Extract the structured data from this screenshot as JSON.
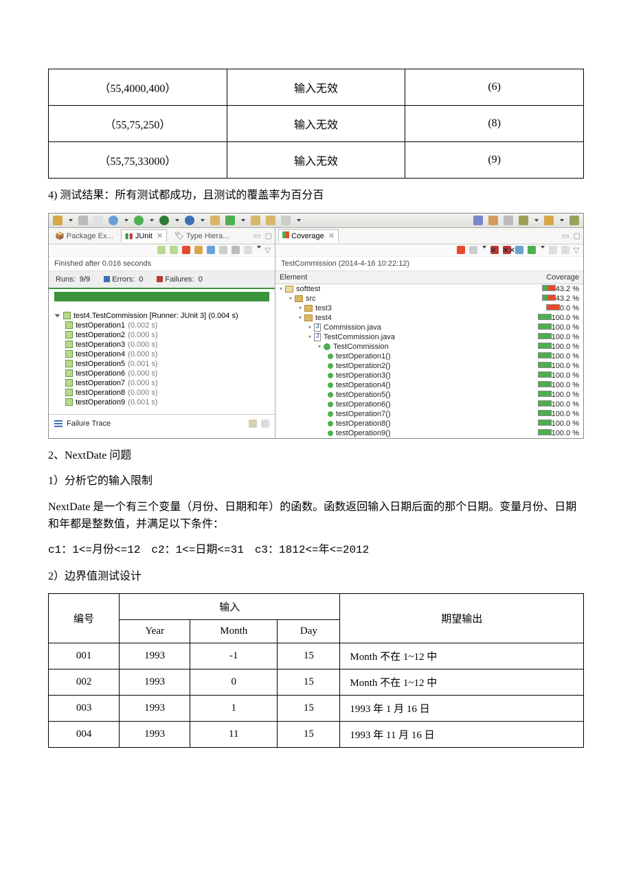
{
  "top_table": {
    "rows": [
      {
        "c1": "（55,4000,400）",
        "c2": "输入无效",
        "c3": "(6)"
      },
      {
        "c1": "（55,75,250）",
        "c2": "输入无效",
        "c3": "(8)"
      },
      {
        "c1": "（55,75,33000）",
        "c2": "输入无效",
        "c3": "(9)"
      }
    ]
  },
  "para_result": "4) 测试结果：所有测试都成功，且测试的覆盖率为百分百",
  "ide": {
    "tabs": {
      "pkg": "Package Ex...",
      "junit": "JUnit",
      "type": "Type Hiera..."
    },
    "finished": "Finished after 0.016 seconds",
    "runs_label": "Runs:",
    "runs_value": "9/9",
    "errors_label": "Errors:",
    "errors_value": "0",
    "failures_label": "Failures:",
    "failures_value": "0",
    "tree_root": "test4.TestCommission [Runner: JUnit 3] (0.004 s)",
    "tests": [
      {
        "name": "testOperation1",
        "time": "(0.002 s)"
      },
      {
        "name": "testOperation2",
        "time": "(0.000 s)"
      },
      {
        "name": "testOperation3",
        "time": "(0.000 s)"
      },
      {
        "name": "testOperation4",
        "time": "(0.000 s)"
      },
      {
        "name": "testOperation5",
        "time": "(0.001 s)"
      },
      {
        "name": "testOperation6",
        "time": "(0.000 s)"
      },
      {
        "name": "testOperation7",
        "time": "(0.000 s)"
      },
      {
        "name": "testOperation8",
        "time": "(0.000 s)"
      },
      {
        "name": "testOperation9",
        "time": "(0.001 s)"
      }
    ],
    "failure_trace": "Failure Trace",
    "coverage": {
      "title": "Coverage",
      "timestamp": "TestCommission (2014-4-16 10:22:12)",
      "head_element": "Element",
      "head_cov": "Coverage",
      "rows": [
        {
          "indent": 0,
          "icon": "project",
          "name": "softtest",
          "pct": "43.2 %",
          "p": 43
        },
        {
          "indent": 1,
          "icon": "src",
          "name": "src",
          "pct": "43.2 %",
          "p": 43
        },
        {
          "indent": 2,
          "icon": "pkg",
          "name": "test3",
          "pct": "0.0 %",
          "p": 0
        },
        {
          "indent": 2,
          "icon": "pkg",
          "name": "test4",
          "pct": "100.0 %",
          "p": 100
        },
        {
          "indent": 3,
          "icon": "jfile",
          "name": "Commission.java",
          "pct": "100.0 %",
          "p": 100
        },
        {
          "indent": 3,
          "icon": "jfile",
          "name": "TestCommission.java",
          "pct": "100.0 %",
          "p": 100
        },
        {
          "indent": 4,
          "icon": "class",
          "name": "TestCommission",
          "pct": "100.0 %",
          "p": 100
        },
        {
          "indent": 5,
          "icon": "method",
          "name": "testOperation1()",
          "pct": "100.0 %",
          "p": 100
        },
        {
          "indent": 5,
          "icon": "method",
          "name": "testOperation2()",
          "pct": "100.0 %",
          "p": 100
        },
        {
          "indent": 5,
          "icon": "method",
          "name": "testOperation3()",
          "pct": "100.0 %",
          "p": 100
        },
        {
          "indent": 5,
          "icon": "method",
          "name": "testOperation4()",
          "pct": "100.0 %",
          "p": 100
        },
        {
          "indent": 5,
          "icon": "method",
          "name": "testOperation5()",
          "pct": "100.0 %",
          "p": 100
        },
        {
          "indent": 5,
          "icon": "method",
          "name": "testOperation6()",
          "pct": "100.0 %",
          "p": 100
        },
        {
          "indent": 5,
          "icon": "method",
          "name": "testOperation7()",
          "pct": "100.0 %",
          "p": 100
        },
        {
          "indent": 5,
          "icon": "method",
          "name": "testOperation8()",
          "pct": "100.0 %",
          "p": 100
        },
        {
          "indent": 5,
          "icon": "method",
          "name": "testOperation9()",
          "pct": "100.0 %",
          "p": 100
        }
      ]
    }
  },
  "section2_title": "2、NextDate 问题",
  "section2_sub1": "1）分析它的输入限制",
  "section2_desc": "NextDate 是一个有三个变量（月份、日期和年）的函数。函数返回输入日期后面的那个日期。变量月份、日期和年都是整数值，并满足以下条件：",
  "section2_cond": "c1：1<=月份<=12　c2：1<=日期<=31　c3：1812<=年<=2012",
  "section2_sub2": "2）边界值测试设计",
  "btable": {
    "h1": "编号",
    "h2": "输入",
    "h3": "期望输出",
    "sh1": "Year",
    "sh2": "Month",
    "sh3": "Day",
    "rows": [
      {
        "id": "001",
        "y": "1993",
        "m": "-1",
        "d": "15",
        "out": "Month 不在 1~12 中"
      },
      {
        "id": "002",
        "y": "1993",
        "m": "0",
        "d": "15",
        "out": "Month 不在 1~12 中"
      },
      {
        "id": "003",
        "y": "1993",
        "m": "1",
        "d": "15",
        "out": "1993 年 1 月 16 日"
      },
      {
        "id": "004",
        "y": "1993",
        "m": "11",
        "d": "15",
        "out": "1993 年 11 月 16 日"
      }
    ]
  }
}
